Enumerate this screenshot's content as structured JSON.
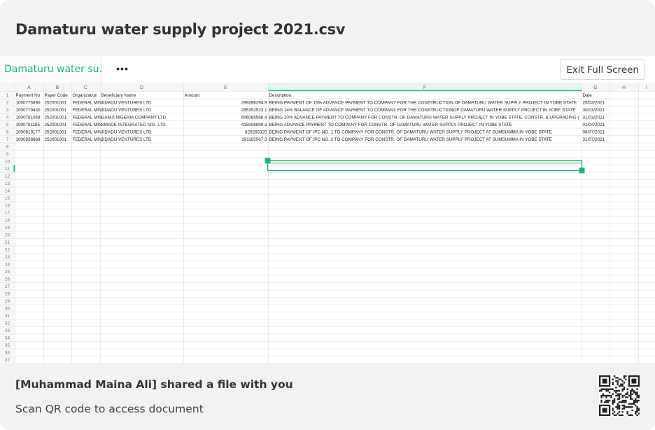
{
  "page": {
    "title": "Damaturu water supply project 2021.csv"
  },
  "toolbar": {
    "tab_label": "Damaturu water su...",
    "more_label": "•••",
    "exit_label": "Exit Full Screen"
  },
  "sheet": {
    "column_letters": [
      "A",
      "B",
      "C",
      "D",
      "E",
      "F",
      "G",
      "H",
      "I"
    ],
    "row_count": 37,
    "header_row": [
      "Payment No",
      "Payer Code",
      "Organization",
      "Beneficiary Name",
      "Amount",
      "Description",
      "Date"
    ],
    "rows": [
      [
        "1000775690",
        "252001001",
        "FEDERAL MIN",
        "JIDADU VENTURES LTD",
        "299286294.9",
        "BEING PAYMENT OF 15% ADVANCE PAYMENT TO COMPANY FOR THE CONSTRUCTION OF DAMATURU WATER SUPPLY PROJECT IN YOBE STATE",
        "25/03/2021"
      ],
      [
        "1000779430",
        "252001001",
        "FEDERAL MIN",
        "JIDADU VENTURES LTD",
        "285352523.1",
        "BEING 14% BALANCE OF ADVANCE PAYMENT TO COMPANY FOR THE CONSTRUCTIONOF DAMATURU WATER SUPPLY PROJECT IN YOBE STATE",
        "30/03/2021"
      ],
      [
        "1000781048",
        "252001001",
        "FEDERAL MIN",
        "GAMJI NIGERIA COMPANY LTD",
        "656066568.4",
        "BEING 20% ADVANCE PAYMENT TO COMPANY FOR CONSTR. OF DAMATURU WATER SUPPLY PROJECT IN YOBE STATE. CONSTR. & UPGRADING (",
        "31/03/2021"
      ],
      [
        "1000781185",
        "252001001",
        "FEDERAL MIN",
        "SMADE INTEGRATED NIG. LTD.",
        "415008899.3",
        "BEING ADVANCE PAYMENT TO COMPANY FOR CONSTR. OF DAMATURU WATER SUPPLY PROJECT IN YOBE STATE",
        "01/04/2021"
      ],
      [
        "1000819177",
        "252001001",
        "FEDERAL MIN",
        "JIDADU VENTURES LTD",
        "820265325",
        "BEING PAYMENT OF IPC NO. 1 TO COMPANY FOR CONSTR. OF DAMATURU WATER SUPPLY PROJECT AT SUMSUMMA IN YOBE STATE",
        "08/07/2021"
      ],
      [
        "1000838868",
        "252001001",
        "FEDERAL MIN",
        "JIDADU VENTURES LTD",
        "191185567.3",
        "BEING PAYMENT OF IPC NO. 2 TO COMPANY FOR CONSTR. OF DAMATURU WATER SUPPLY PROJECT AT SUMSUMMA IN YOBE STATE",
        "31/07/2021"
      ]
    ],
    "accent_color": "#21b573"
  },
  "footer": {
    "shared_text": "[Muhammad Maina Ali] shared a file with you",
    "scan_text": "Scan QR code to access document"
  }
}
